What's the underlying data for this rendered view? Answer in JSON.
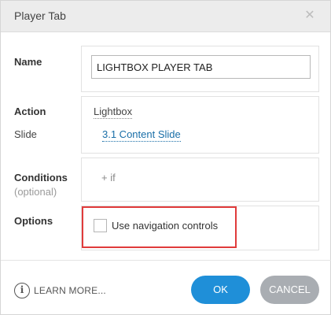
{
  "dialog": {
    "title": "Player Tab",
    "close_glyph": "✕"
  },
  "fields": {
    "name_label": "Name",
    "name_value": "LIGHTBOX PLAYER TAB",
    "action_label": "Action",
    "action_value": "Lightbox",
    "slide_label": "Slide",
    "slide_value": "3.1 Content Slide",
    "conditions_label": "Conditions",
    "conditions_sublabel": "(optional)",
    "conditions_add": "+ if",
    "options_label": "Options",
    "nav_controls_label": "Use navigation controls",
    "nav_controls_checked": false
  },
  "footer": {
    "info_glyph": "i",
    "learn_more": "LEARN MORE...",
    "ok_label": "OK",
    "cancel_label": "CANCEL"
  },
  "colors": {
    "ok_button": "#1f8fd8",
    "cancel_button": "#a9adb2",
    "highlight_border": "#e03b3b",
    "link": "#1a6fa8"
  },
  "icons": {
    "close": "close-icon",
    "info": "info-icon"
  }
}
